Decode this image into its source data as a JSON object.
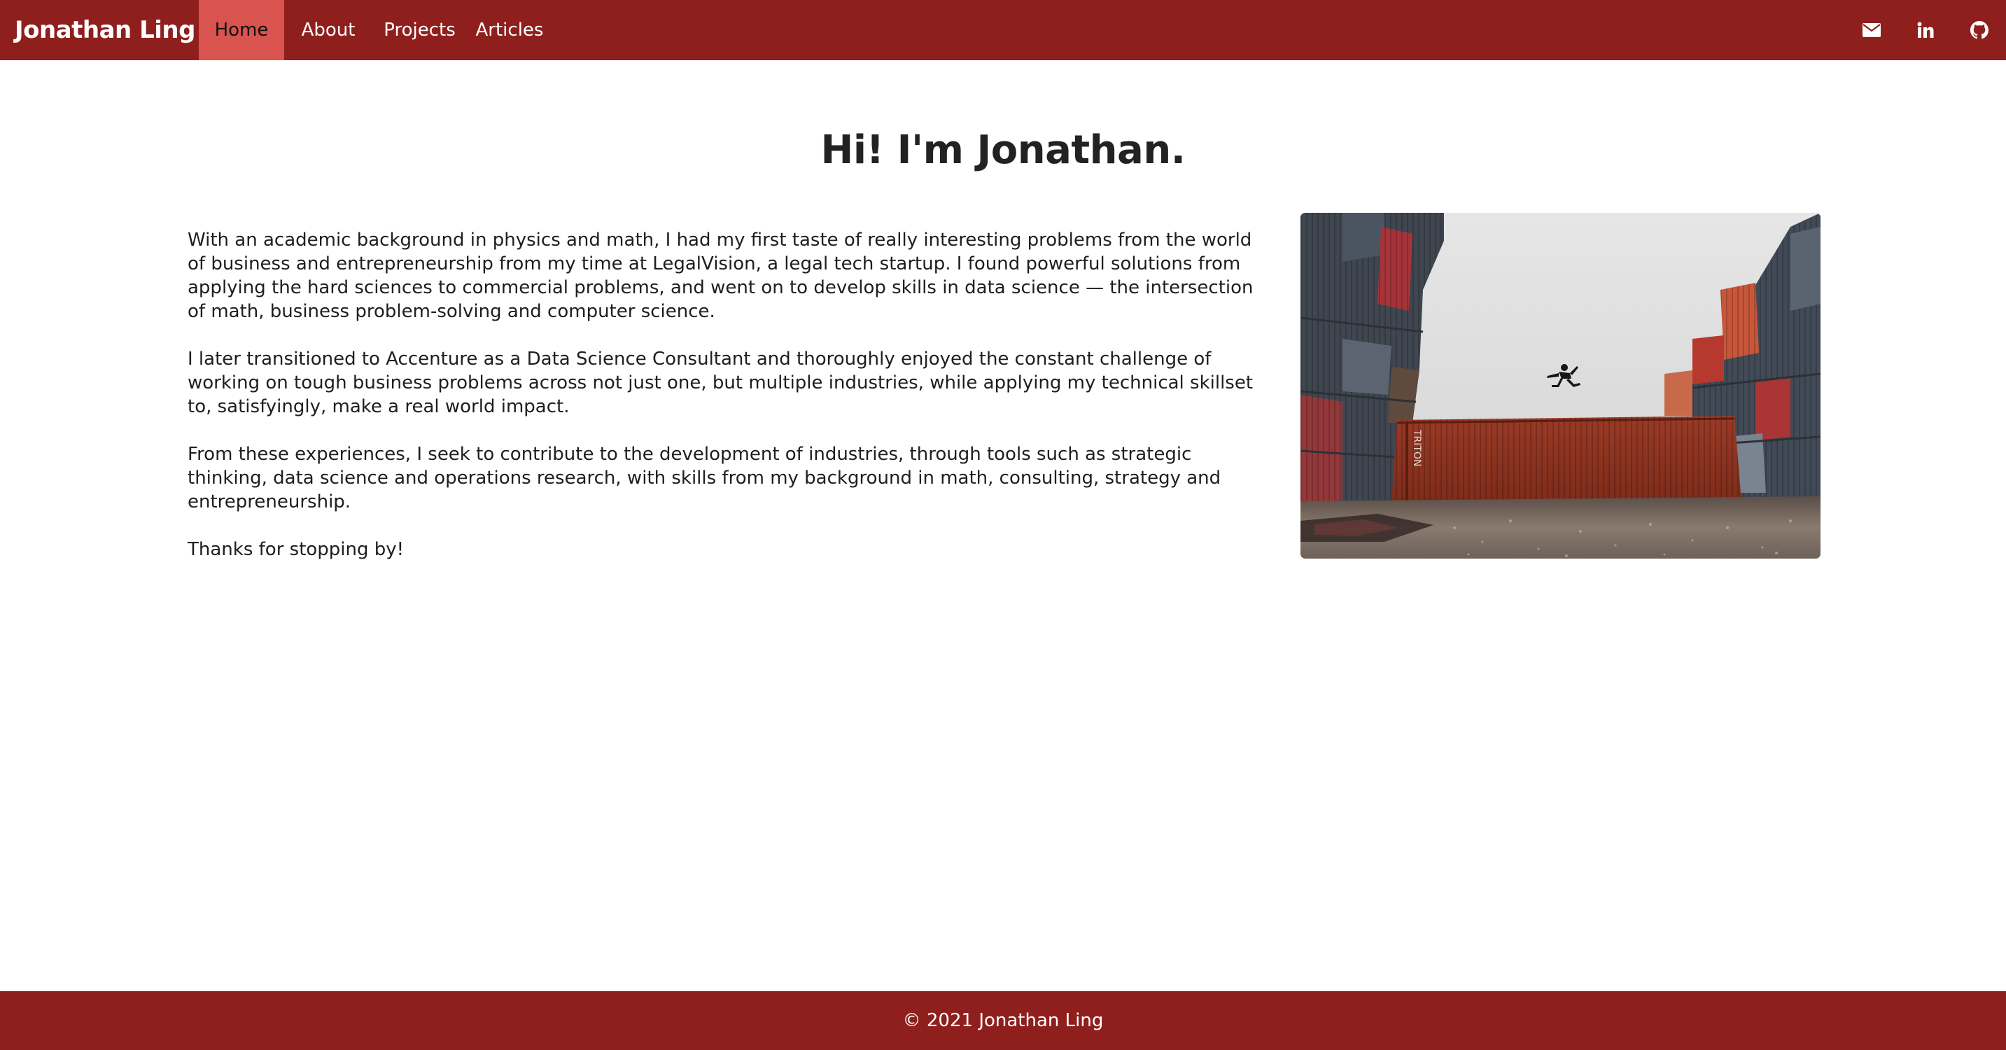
{
  "brand": {
    "name": "Jonathan Ling"
  },
  "nav": {
    "items": [
      {
        "label": "Home",
        "active": true
      },
      {
        "label": "About",
        "active": false
      },
      {
        "label": "Projects",
        "active": false
      },
      {
        "label": "Articles",
        "active": false
      }
    ],
    "icons": [
      "envelope-icon",
      "linkedin-icon",
      "github-icon"
    ]
  },
  "main": {
    "title": "Hi! I'm Jonathan.",
    "paragraphs": [
      "With an academic background in physics and math, I had my first taste of really interesting problems from the world of business and entrepreneurship from my time at LegalVision, a legal tech startup. I found powerful solutions from applying the hard sciences to commercial problems, and went on to develop skills in data science — the intersection of math, business problem-solving and computer science.",
      "I later transitioned to Accenture as a Data Science Consultant and thoroughly enjoyed the constant challenge of working on tough business problems across not just one, but multiple industries, while applying my technical skillset to, satisfyingly, make a real world impact.",
      "From these experiences, I seek to contribute to the development of industries, through tools such as strategic thinking, data science and operations research, with skills from my background in math, consulting, strategy and entrepreneurship.",
      "Thanks for stopping by!"
    ],
    "image": {
      "container_label": "TRITON"
    }
  },
  "footer": {
    "text": "© 2021 Jonathan Ling"
  },
  "colors": {
    "brand": "#8f1f1d",
    "nav_active": "#d9534f",
    "text": "#222222"
  }
}
